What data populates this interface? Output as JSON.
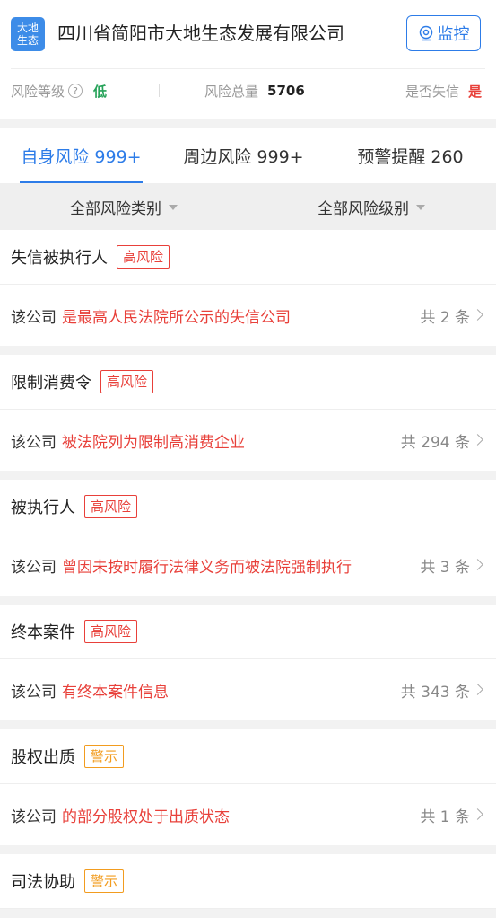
{
  "header": {
    "logo_line1": "大地",
    "logo_line2": "生态",
    "company_name": "四川省简阳市大地生态发展有限公司",
    "monitor_label": "监控"
  },
  "stats": {
    "risk_level_label": "风险等级",
    "risk_level_value": "低",
    "risk_total_label": "风险总量",
    "risk_total_value": "5706",
    "dishonest_label": "是否失信",
    "dishonest_value": "是"
  },
  "tabs": [
    {
      "label": "自身风险 999+"
    },
    {
      "label": "周边风险 999+"
    },
    {
      "label": "预警提醒 260"
    }
  ],
  "filters": {
    "category": "全部风险类别",
    "level": "全部风险级别"
  },
  "items": [
    {
      "title": "失信被执行人",
      "badge": "高风险",
      "prefix": "该公司",
      "desc": "是最高人民法院所公示的失信公司",
      "count": "共 2 条"
    },
    {
      "title": "限制消费令",
      "badge": "高风险",
      "prefix": "该公司",
      "desc": "被法院列为限制高消费企业",
      "count": "共 294 条"
    },
    {
      "title": "被执行人",
      "badge": "高风险",
      "prefix": "该公司",
      "desc": "曾因未按时履行法律义务而被法院强制执行",
      "count": "共 3 条"
    },
    {
      "title": "终本案件",
      "badge": "高风险",
      "prefix": "该公司",
      "desc": "有终本案件信息",
      "count": "共 343 条"
    },
    {
      "title": "股权出质",
      "badge": "警示",
      "prefix": "该公司",
      "desc": "的部分股权处于出质状态",
      "count": "共 1 条"
    },
    {
      "title": "司法协助",
      "badge": "警示"
    }
  ],
  "colors": {
    "accent": "#2d7ce8",
    "danger": "#e8403a",
    "warning": "#f29c1f",
    "ok": "#27a35a"
  }
}
